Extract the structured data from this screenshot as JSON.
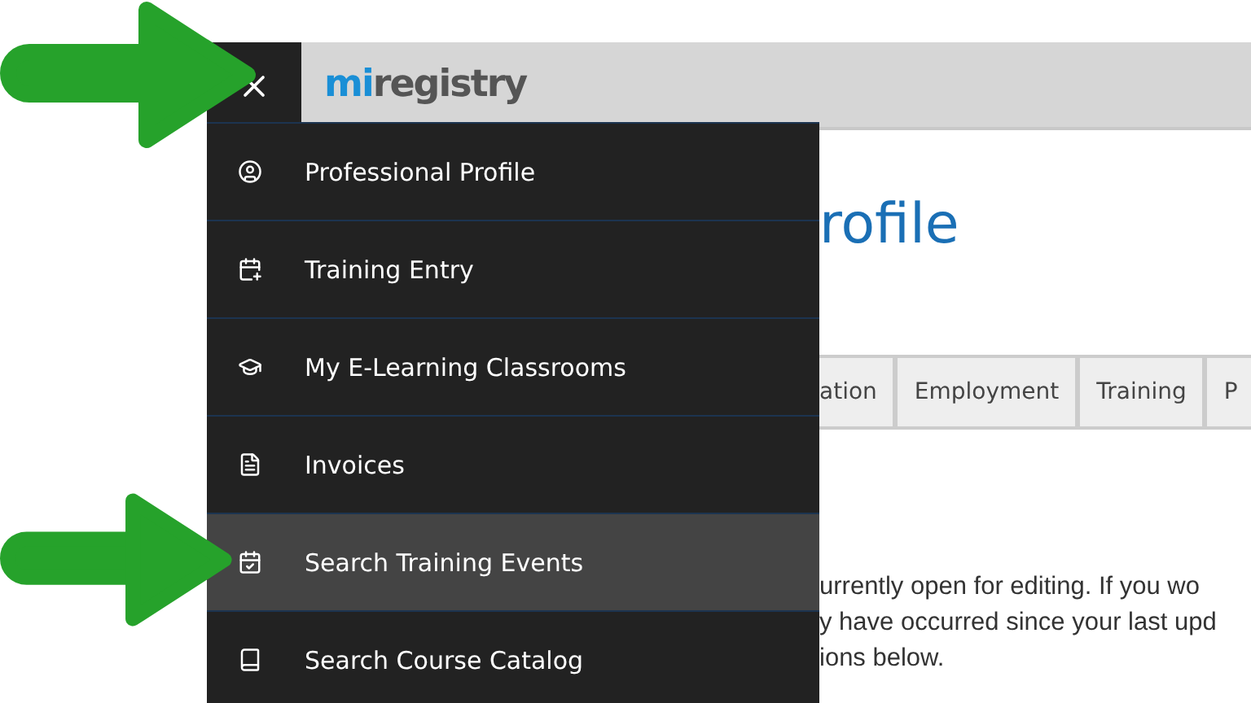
{
  "header": {
    "logo": {
      "prefix": "mi",
      "suffix": "registry"
    }
  },
  "menu": {
    "items": [
      {
        "label": "Professional Profile",
        "selected": false
      },
      {
        "label": "Training Entry",
        "selected": false
      },
      {
        "label": "My E-Learning Classrooms",
        "selected": false
      },
      {
        "label": "Invoices",
        "selected": false
      },
      {
        "label": "Search Training Events",
        "selected": true
      },
      {
        "label": "Search Course Catalog",
        "selected": false
      }
    ]
  },
  "page": {
    "title": "rofile",
    "tabs": [
      "ation",
      "Employment",
      "Training",
      "P"
    ],
    "notice_lines": [
      "urrently open for editing. If you wo",
      "y have occurred since your last upd",
      "ions below."
    ]
  }
}
